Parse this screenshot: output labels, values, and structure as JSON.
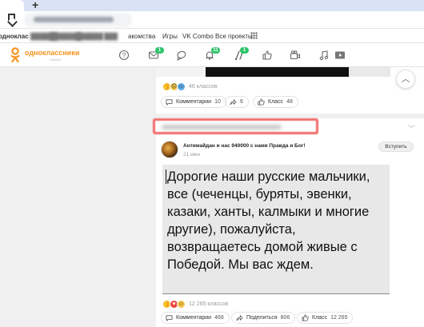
{
  "browser": {
    "new_tab_symbol": "+",
    "bookmarks": [
      {
        "label": "одноклас",
        "blurred": false
      },
      {
        "label": "",
        "blurred": true
      },
      {
        "label": "",
        "blurred": true
      },
      {
        "label": "",
        "blurred": true
      },
      {
        "label": "",
        "blurred": true
      },
      {
        "label": "акомства",
        "blurred": false
      },
      {
        "label": "Игры",
        "blurred": false
      },
      {
        "label": "VK Combo",
        "blurred": false
      },
      {
        "label": "Все проекты",
        "blurred": false
      }
    ]
  },
  "header": {
    "site_name": "одноклассники",
    "nav": [
      {
        "icon": "help-icon",
        "badge": ""
      },
      {
        "icon": "messages-icon",
        "badge": "1"
      },
      {
        "icon": "discussions-icon",
        "badge": ""
      },
      {
        "icon": "notifications-icon",
        "badge": "11"
      },
      {
        "icon": "guests-icon",
        "badge": "1"
      },
      {
        "icon": "likes-icon",
        "badge": ""
      },
      {
        "icon": "video-icon",
        "badge": ""
      },
      {
        "icon": "music-icon",
        "badge": ""
      }
    ]
  },
  "feed": {
    "post1": {
      "reactions_count": "46 классов",
      "actions": {
        "comments_label": "Комментарии",
        "comments_count": "10",
        "share_count": "6",
        "like_label": "Класс",
        "like_count": "48"
      }
    },
    "post2": {
      "group_name": "Антимайдан и нас 940000 с нами Правда и Бог!",
      "date": "21 июн",
      "join_label": "Вступить",
      "text": "Дорогие наши русские мальчики, все (чеченцы, буряты, эвенки, казаки, ханты, калмыки и многие другие), пожалуйста, возвращаетесь домой живые с Победой. Мы вас ждем.",
      "reactions_count": "12 265 классов",
      "actions": {
        "comments_label": "Комментарии",
        "comments_count": "468",
        "share_label": "Поделиться",
        "share_count": "806",
        "like_label": "Класс",
        "like_count": "12 265"
      }
    }
  },
  "colors": {
    "brand_orange": "#f7931e",
    "badge_green": "#2ec46b",
    "highlight_red": "#f26b6b"
  }
}
